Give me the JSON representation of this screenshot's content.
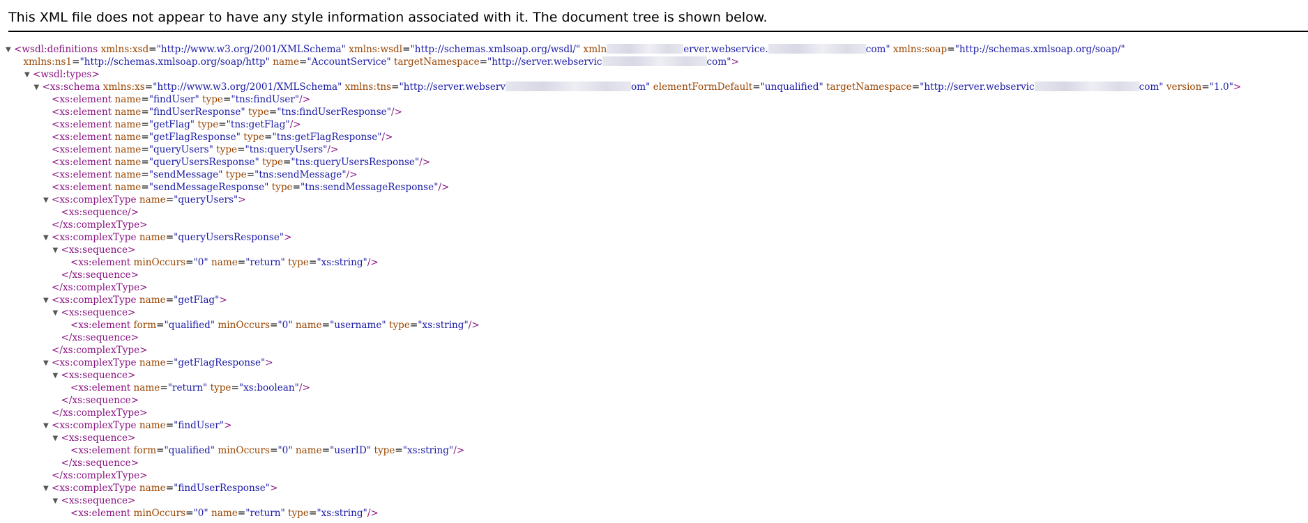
{
  "header": {
    "notice": "This XML file does not appear to have any style information associated with it. The document tree is shown below."
  },
  "tree": {
    "lines": [
      {
        "indent": 0,
        "toggle": "▼",
        "name": "wsdl-definitions-open",
        "parts": [
          [
            "tag",
            "<wsdl:definitions"
          ],
          [
            "attr",
            " xmlns:xsd"
          ],
          [
            "txt",
            "="
          ],
          [
            "val",
            "\"http://www.w3.org/2001/XMLSchema\""
          ],
          [
            "attr",
            " xmlns:wsdl"
          ],
          [
            "txt",
            "="
          ],
          [
            "val",
            "\"http://schemas.xmlsoap.org/wsdl/\""
          ],
          [
            "attr",
            " xmln"
          ],
          [
            "redact-110",
            ""
          ],
          [
            "val",
            "erver.webservice."
          ],
          [
            "redact-140",
            ""
          ],
          [
            "val",
            "com\""
          ],
          [
            "attr",
            " xmlns:soap"
          ],
          [
            "txt",
            "="
          ],
          [
            "val",
            "\"http://schemas.xmlsoap.org/soap/\""
          ]
        ]
      },
      {
        "indent": 1,
        "toggle": "",
        "name": "wsdl-definitions-open-cont",
        "parts": [
          [
            "attr",
            "xmlns:ns1"
          ],
          [
            "txt",
            "="
          ],
          [
            "val",
            "\"http://schemas.xmlsoap.org/soap/http\""
          ],
          [
            "attr",
            " name"
          ],
          [
            "txt",
            "="
          ],
          [
            "val",
            "\"AccountService\""
          ],
          [
            "attr",
            " targetNamespace"
          ],
          [
            "txt",
            "="
          ],
          [
            "val",
            "\"http://server.webservic"
          ],
          [
            "redact-150",
            ""
          ],
          [
            "val",
            "com\""
          ],
          [
            "tag",
            ">"
          ]
        ]
      },
      {
        "indent": 2,
        "toggle": "▼",
        "name": "wsdl-types-open",
        "parts": [
          [
            "tag",
            "<wsdl:types>"
          ]
        ]
      },
      {
        "indent": 3,
        "toggle": "▼",
        "name": "xs-schema-open",
        "parts": [
          [
            "tag",
            "<xs:schema"
          ],
          [
            "attr",
            " xmlns:xs"
          ],
          [
            "txt",
            "="
          ],
          [
            "val",
            "\"http://www.w3.org/2001/XMLSchema\""
          ],
          [
            "attr",
            " xmlns:tns"
          ],
          [
            "txt",
            "="
          ],
          [
            "val",
            "\"http://server.webserv"
          ],
          [
            "redact-180",
            ""
          ],
          [
            "val",
            "om\""
          ],
          [
            "attr",
            " elementFormDefault"
          ],
          [
            "txt",
            "="
          ],
          [
            "val",
            "\"unqualified\""
          ],
          [
            "attr",
            " targetNamespace"
          ],
          [
            "txt",
            "="
          ],
          [
            "val",
            "\"http://server.webservic"
          ],
          [
            "redact-150",
            ""
          ],
          [
            "val",
            "com\""
          ],
          [
            "attr",
            " version"
          ],
          [
            "txt",
            "="
          ],
          [
            "val",
            "\"1.0\""
          ],
          [
            "tag",
            ">"
          ]
        ]
      },
      {
        "indent": 4,
        "toggle": "",
        "name": "element-findUser",
        "parts": [
          [
            "tag",
            "<xs:element"
          ],
          [
            "attr",
            " name"
          ],
          [
            "txt",
            "="
          ],
          [
            "val",
            "\"findUser\""
          ],
          [
            "attr",
            " type"
          ],
          [
            "txt",
            "="
          ],
          [
            "val",
            "\"tns:findUser\""
          ],
          [
            "tag",
            "/>"
          ]
        ]
      },
      {
        "indent": 4,
        "toggle": "",
        "name": "element-findUserResponse",
        "parts": [
          [
            "tag",
            "<xs:element"
          ],
          [
            "attr",
            " name"
          ],
          [
            "txt",
            "="
          ],
          [
            "val",
            "\"findUserResponse\""
          ],
          [
            "attr",
            " type"
          ],
          [
            "txt",
            "="
          ],
          [
            "val",
            "\"tns:findUserResponse\""
          ],
          [
            "tag",
            "/>"
          ]
        ]
      },
      {
        "indent": 4,
        "toggle": "",
        "name": "element-getFlag",
        "parts": [
          [
            "tag",
            "<xs:element"
          ],
          [
            "attr",
            " name"
          ],
          [
            "txt",
            "="
          ],
          [
            "val",
            "\"getFlag\""
          ],
          [
            "attr",
            " type"
          ],
          [
            "txt",
            "="
          ],
          [
            "val",
            "\"tns:getFlag\""
          ],
          [
            "tag",
            "/>"
          ]
        ]
      },
      {
        "indent": 4,
        "toggle": "",
        "name": "element-getFlagResponse",
        "parts": [
          [
            "tag",
            "<xs:element"
          ],
          [
            "attr",
            " name"
          ],
          [
            "txt",
            "="
          ],
          [
            "val",
            "\"getFlagResponse\""
          ],
          [
            "attr",
            " type"
          ],
          [
            "txt",
            "="
          ],
          [
            "val",
            "\"tns:getFlagResponse\""
          ],
          [
            "tag",
            "/>"
          ]
        ]
      },
      {
        "indent": 4,
        "toggle": "",
        "name": "element-queryUsers",
        "parts": [
          [
            "tag",
            "<xs:element"
          ],
          [
            "attr",
            " name"
          ],
          [
            "txt",
            "="
          ],
          [
            "val",
            "\"queryUsers\""
          ],
          [
            "attr",
            " type"
          ],
          [
            "txt",
            "="
          ],
          [
            "val",
            "\"tns:queryUsers\""
          ],
          [
            "tag",
            "/>"
          ]
        ]
      },
      {
        "indent": 4,
        "toggle": "",
        "name": "element-queryUsersResponse",
        "parts": [
          [
            "tag",
            "<xs:element"
          ],
          [
            "attr",
            " name"
          ],
          [
            "txt",
            "="
          ],
          [
            "val",
            "\"queryUsersResponse\""
          ],
          [
            "attr",
            " type"
          ],
          [
            "txt",
            "="
          ],
          [
            "val",
            "\"tns:queryUsersResponse\""
          ],
          [
            "tag",
            "/>"
          ]
        ]
      },
      {
        "indent": 4,
        "toggle": "",
        "name": "element-sendMessage",
        "parts": [
          [
            "tag",
            "<xs:element"
          ],
          [
            "attr",
            " name"
          ],
          [
            "txt",
            "="
          ],
          [
            "val",
            "\"sendMessage\""
          ],
          [
            "attr",
            " type"
          ],
          [
            "txt",
            "="
          ],
          [
            "val",
            "\"tns:sendMessage\""
          ],
          [
            "tag",
            "/>"
          ]
        ]
      },
      {
        "indent": 4,
        "toggle": "",
        "name": "element-sendMessageResponse",
        "parts": [
          [
            "tag",
            "<xs:element"
          ],
          [
            "attr",
            " name"
          ],
          [
            "txt",
            "="
          ],
          [
            "val",
            "\"sendMessageResponse\""
          ],
          [
            "attr",
            " type"
          ],
          [
            "txt",
            "="
          ],
          [
            "val",
            "\"tns:sendMessageResponse\""
          ],
          [
            "tag",
            "/>"
          ]
        ]
      },
      {
        "indent": 4,
        "toggle": "▼",
        "name": "complexType-queryUsers-open",
        "parts": [
          [
            "tag",
            "<xs:complexType"
          ],
          [
            "attr",
            " name"
          ],
          [
            "txt",
            "="
          ],
          [
            "val",
            "\"queryUsers\""
          ],
          [
            "tag",
            ">"
          ]
        ]
      },
      {
        "indent": 5,
        "toggle": "",
        "name": "sequence-empty",
        "parts": [
          [
            "tag",
            "<xs:sequence/>"
          ]
        ]
      },
      {
        "indent": 4,
        "toggle": "",
        "name": "complexType-close",
        "parts": [
          [
            "tag",
            "</xs:complexType>"
          ]
        ]
      },
      {
        "indent": 4,
        "toggle": "▼",
        "name": "complexType-queryUsersResponse-open",
        "parts": [
          [
            "tag",
            "<xs:complexType"
          ],
          [
            "attr",
            " name"
          ],
          [
            "txt",
            "="
          ],
          [
            "val",
            "\"queryUsersResponse\""
          ],
          [
            "tag",
            ">"
          ]
        ]
      },
      {
        "indent": 5,
        "toggle": "▼",
        "name": "sequence-open",
        "parts": [
          [
            "tag",
            "<xs:sequence>"
          ]
        ]
      },
      {
        "indent": 6,
        "toggle": "",
        "name": "element-return-string",
        "parts": [
          [
            "tag",
            "<xs:element"
          ],
          [
            "attr",
            " minOccurs"
          ],
          [
            "txt",
            "="
          ],
          [
            "val",
            "\"0\""
          ],
          [
            "attr",
            " name"
          ],
          [
            "txt",
            "="
          ],
          [
            "val",
            "\"return\""
          ],
          [
            "attr",
            " type"
          ],
          [
            "txt",
            "="
          ],
          [
            "val",
            "\"xs:string\""
          ],
          [
            "tag",
            "/>"
          ]
        ]
      },
      {
        "indent": 5,
        "toggle": "",
        "name": "sequence-close",
        "parts": [
          [
            "tag",
            "</xs:sequence>"
          ]
        ]
      },
      {
        "indent": 4,
        "toggle": "",
        "name": "complexType-close",
        "parts": [
          [
            "tag",
            "</xs:complexType>"
          ]
        ]
      },
      {
        "indent": 4,
        "toggle": "▼",
        "name": "complexType-getFlag-open",
        "parts": [
          [
            "tag",
            "<xs:complexType"
          ],
          [
            "attr",
            " name"
          ],
          [
            "txt",
            "="
          ],
          [
            "val",
            "\"getFlag\""
          ],
          [
            "tag",
            ">"
          ]
        ]
      },
      {
        "indent": 5,
        "toggle": "▼",
        "name": "sequence-open",
        "parts": [
          [
            "tag",
            "<xs:sequence>"
          ]
        ]
      },
      {
        "indent": 6,
        "toggle": "",
        "name": "element-username",
        "parts": [
          [
            "tag",
            "<xs:element"
          ],
          [
            "attr",
            " form"
          ],
          [
            "txt",
            "="
          ],
          [
            "val",
            "\"qualified\""
          ],
          [
            "attr",
            " minOccurs"
          ],
          [
            "txt",
            "="
          ],
          [
            "val",
            "\"0\""
          ],
          [
            "attr",
            " name"
          ],
          [
            "txt",
            "="
          ],
          [
            "val",
            "\"username\""
          ],
          [
            "attr",
            " type"
          ],
          [
            "txt",
            "="
          ],
          [
            "val",
            "\"xs:string\""
          ],
          [
            "tag",
            "/>"
          ]
        ]
      },
      {
        "indent": 5,
        "toggle": "",
        "name": "sequence-close",
        "parts": [
          [
            "tag",
            "</xs:sequence>"
          ]
        ]
      },
      {
        "indent": 4,
        "toggle": "",
        "name": "complexType-close",
        "parts": [
          [
            "tag",
            "</xs:complexType>"
          ]
        ]
      },
      {
        "indent": 4,
        "toggle": "▼",
        "name": "complexType-getFlagResponse-open",
        "parts": [
          [
            "tag",
            "<xs:complexType"
          ],
          [
            "attr",
            " name"
          ],
          [
            "txt",
            "="
          ],
          [
            "val",
            "\"getFlagResponse\""
          ],
          [
            "tag",
            ">"
          ]
        ]
      },
      {
        "indent": 5,
        "toggle": "▼",
        "name": "sequence-open",
        "parts": [
          [
            "tag",
            "<xs:sequence>"
          ]
        ]
      },
      {
        "indent": 6,
        "toggle": "",
        "name": "element-return-boolean",
        "parts": [
          [
            "tag",
            "<xs:element"
          ],
          [
            "attr",
            " name"
          ],
          [
            "txt",
            "="
          ],
          [
            "val",
            "\"return\""
          ],
          [
            "attr",
            " type"
          ],
          [
            "txt",
            "="
          ],
          [
            "val",
            "\"xs:boolean\""
          ],
          [
            "tag",
            "/>"
          ]
        ]
      },
      {
        "indent": 5,
        "toggle": "",
        "name": "sequence-close",
        "parts": [
          [
            "tag",
            "</xs:sequence>"
          ]
        ]
      },
      {
        "indent": 4,
        "toggle": "",
        "name": "complexType-close",
        "parts": [
          [
            "tag",
            "</xs:complexType>"
          ]
        ]
      },
      {
        "indent": 4,
        "toggle": "▼",
        "name": "complexType-findUser-open",
        "parts": [
          [
            "tag",
            "<xs:complexType"
          ],
          [
            "attr",
            " name"
          ],
          [
            "txt",
            "="
          ],
          [
            "val",
            "\"findUser\""
          ],
          [
            "tag",
            ">"
          ]
        ]
      },
      {
        "indent": 5,
        "toggle": "▼",
        "name": "sequence-open",
        "parts": [
          [
            "tag",
            "<xs:sequence>"
          ]
        ]
      },
      {
        "indent": 6,
        "toggle": "",
        "name": "element-userID",
        "parts": [
          [
            "tag",
            "<xs:element"
          ],
          [
            "attr",
            " form"
          ],
          [
            "txt",
            "="
          ],
          [
            "val",
            "\"qualified\""
          ],
          [
            "attr",
            " minOccurs"
          ],
          [
            "txt",
            "="
          ],
          [
            "val",
            "\"0\""
          ],
          [
            "attr",
            " name"
          ],
          [
            "txt",
            "="
          ],
          [
            "val",
            "\"userID\""
          ],
          [
            "attr",
            " type"
          ],
          [
            "txt",
            "="
          ],
          [
            "val",
            "\"xs:string\""
          ],
          [
            "tag",
            "/>"
          ]
        ]
      },
      {
        "indent": 5,
        "toggle": "",
        "name": "sequence-close",
        "parts": [
          [
            "tag",
            "</xs:sequence>"
          ]
        ]
      },
      {
        "indent": 4,
        "toggle": "",
        "name": "complexType-close",
        "parts": [
          [
            "tag",
            "</xs:complexType>"
          ]
        ]
      },
      {
        "indent": 4,
        "toggle": "▼",
        "name": "complexType-findUserResponse-open",
        "parts": [
          [
            "tag",
            "<xs:complexType"
          ],
          [
            "attr",
            " name"
          ],
          [
            "txt",
            "="
          ],
          [
            "val",
            "\"findUserResponse\""
          ],
          [
            "tag",
            ">"
          ]
        ]
      },
      {
        "indent": 5,
        "toggle": "▼",
        "name": "sequence-open",
        "parts": [
          [
            "tag",
            "<xs:sequence>"
          ]
        ]
      },
      {
        "indent": 6,
        "toggle": "",
        "name": "element-return-string",
        "parts": [
          [
            "tag",
            "<xs:element"
          ],
          [
            "attr",
            " minOccurs"
          ],
          [
            "txt",
            "="
          ],
          [
            "val",
            "\"0\""
          ],
          [
            "attr",
            " name"
          ],
          [
            "txt",
            "="
          ],
          [
            "val",
            "\"return\""
          ],
          [
            "attr",
            " type"
          ],
          [
            "txt",
            "="
          ],
          [
            "val",
            "\"xs:string\""
          ],
          [
            "tag",
            "/>"
          ]
        ]
      }
    ]
  },
  "colors": {
    "tag": "#881280",
    "attr": "#994500",
    "value": "#1a1aa6",
    "toggle": "#555555"
  }
}
